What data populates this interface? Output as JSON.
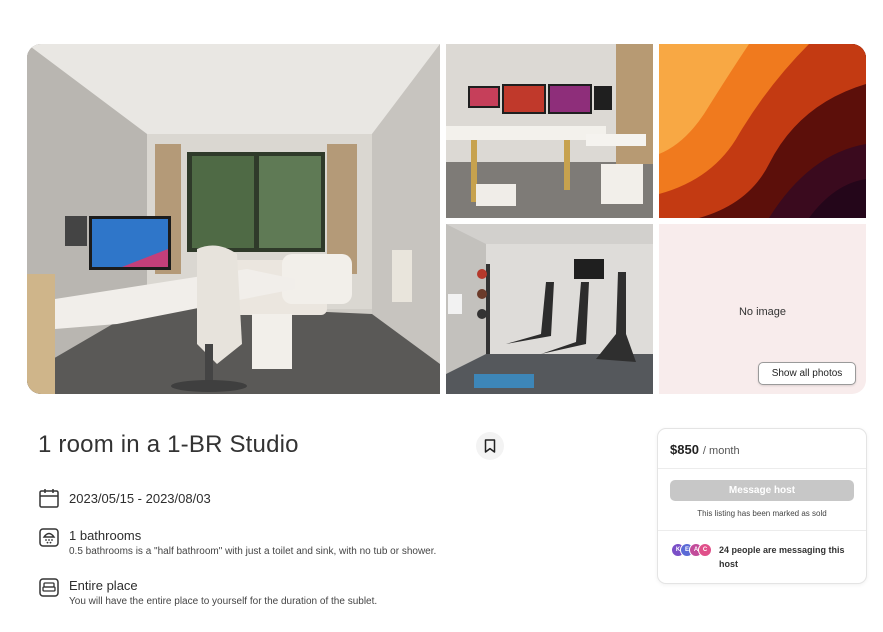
{
  "gallery": {
    "photos": [
      {
        "name": "bedroom with desk and window"
      },
      {
        "name": "desk with monitors"
      },
      {
        "name": "orange abstract wallpaper"
      },
      {
        "name": "gym with treadmills"
      }
    ],
    "no_image_text": "No image",
    "show_all_label": "Show all photos"
  },
  "listing": {
    "title": "1 room in a 1-BR Studio",
    "save_icon": "bookmark-icon",
    "dates": "2023/05/15 - 2023/08/03",
    "bathrooms": {
      "title": "1 bathrooms",
      "description": "0.5 bathrooms is a \"half bathroom\" with just a toilet and sink, with no tub or shower."
    },
    "place": {
      "title": "Entire place",
      "description": "You will have the entire place to yourself for the duration of the sublet."
    }
  },
  "booking_card": {
    "price": "$850",
    "period": "/ month",
    "message_button": "Message host",
    "status_text": "This listing has been marked as sold",
    "messaging_count_text": "24 people are messaging this host",
    "avatars": [
      {
        "letter": "K",
        "color": "#7a4fc7"
      },
      {
        "letter": "E",
        "color": "#5b6ad6"
      },
      {
        "letter": "A",
        "color": "#c24b9a"
      },
      {
        "letter": "C",
        "color": "#e0508a"
      }
    ]
  },
  "colors": {
    "text": "#2c2c2c",
    "button_disabled": "#c7c7c7",
    "no_image_bg": "#f8ecec"
  }
}
